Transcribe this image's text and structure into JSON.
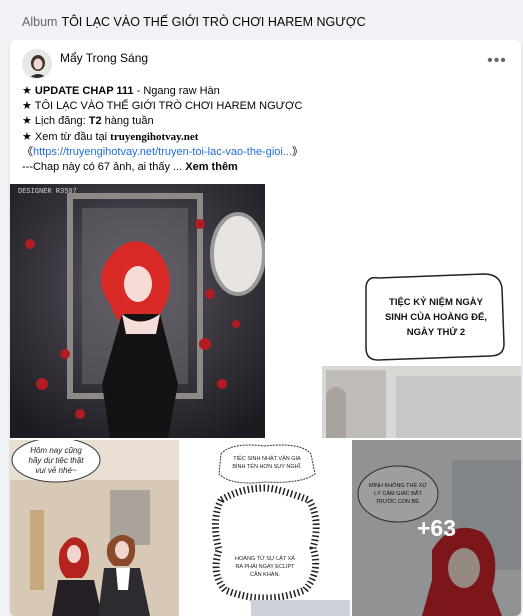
{
  "album": {
    "prefix": "Album",
    "title": "TÔI LẠC VÀO THẾ GIỚI TRÒ CHƠI HAREM NGƯỢC"
  },
  "post": {
    "author": "Mẩy Trong Sáng",
    "more_icon": "more-horizontal-icon",
    "lines": {
      "l1_bold": "UPDATE CHAP 111",
      "l1_rest": " - Ngang raw Hàn",
      "l2": "TÔI LẠC VÀO THẾ GIỚI TRÒ CHƠI HAREM NGƯỢC",
      "l3_prefix": "Lịch đăng: ",
      "l3_bold": "T2",
      "l3_rest": " hàng tuần",
      "l4_prefix": "Xem từ đầu tại ",
      "l4_bold": "truyengihotvay.net",
      "l5_link": "https://truyengihotvay.net/truyen-toi-lac-vao-the-gioi...",
      "l6_text": "---Chap này có 67 ảnh, ai thấy ... ",
      "l6_seemore": "Xem thêm"
    },
    "star": "★",
    "bracket_open": "《",
    "bracket_close": "》"
  },
  "media": {
    "main_watermark": "DESIGNER R3507",
    "caption_right": [
      "TIỆC KỶ NIỆM NGÀY",
      "SINH CỦA HOÀNG ĐẾ,",
      "NGÀY THỨ 2"
    ],
    "b1_speech": [
      "Hôm nay cũng",
      "hãy dự tiệc thật",
      "vui vẻ nhé~"
    ],
    "b2_speech_top": [
      "TIỆC SINH NHẬT VẬN GIA",
      "BÌNH TÊN HƠN SUY NGHĨ."
    ],
    "b2_speech_mid": [
      "HOÀNG TỬ SỰ LẬT XẢ",
      "RA PHẢI NGAY ECLIPT",
      "CẦN KHÁN."
    ],
    "b3_speech": [
      "MÌNH KHÔNG THỂ XỬ",
      "LÝ CẢM GIÁC BẤT",
      "TRƯỚC CON BÉ."
    ],
    "more_count": "+63"
  }
}
